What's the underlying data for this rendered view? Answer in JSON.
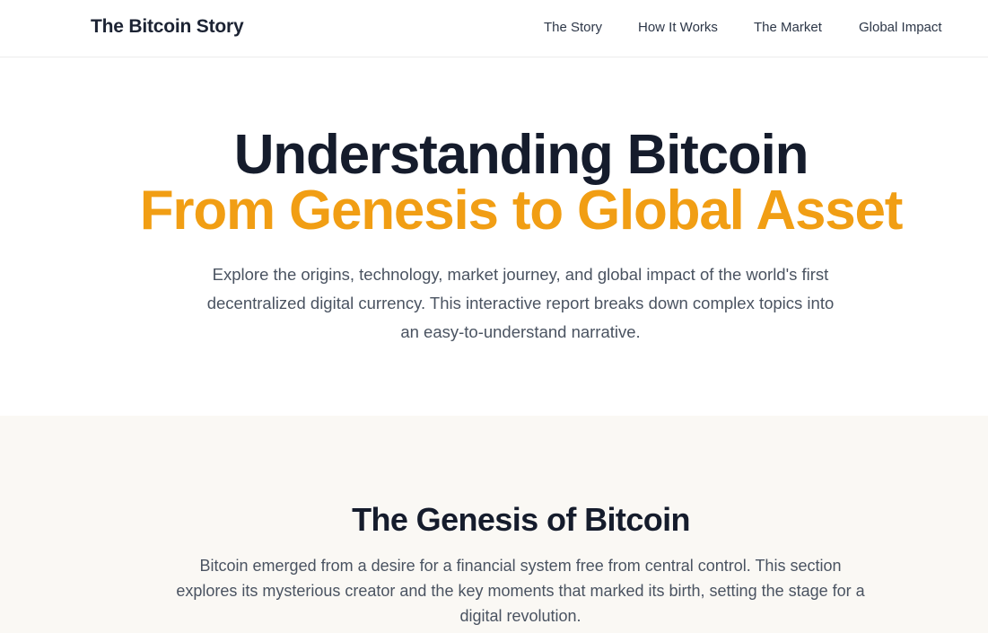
{
  "nav": {
    "brand": "The Bitcoin Story",
    "links": [
      "The Story",
      "How It Works",
      "The Market",
      "Global Impact"
    ]
  },
  "hero": {
    "title_line1": "Understanding Bitcoin",
    "title_line2": "From Genesis to Global Asset",
    "description": "Explore the origins, technology, market journey, and global impact of the world's first decentralized digital currency. This interactive report breaks down complex topics into an easy-to-understand narrative."
  },
  "genesis": {
    "title": "The Genesis of Bitcoin",
    "description": "Bitcoin emerged from a desire for a financial system free from central control. This section explores its mysterious creator and the key moments that marked its birth, setting the stage for a digital revolution."
  },
  "colors": {
    "accent": "#f19e14",
    "heading": "#151c2c",
    "section_bg": "#faf8f4"
  }
}
